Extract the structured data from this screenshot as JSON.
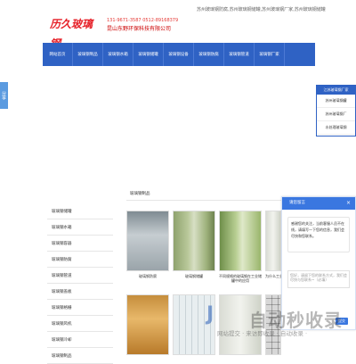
{
  "header": {
    "logo_text": "历久玻璃钢",
    "phone": "131-9671-3587  0512-89168379",
    "company": "昆山东野环保科技有限公司",
    "keywords": "苏州玻璃钢防腐,苏州玻璃钢储罐,苏州玻璃钢厂家,苏州玻璃钢储罐"
  },
  "nav": [
    "网站首页",
    "玻璃钢制品",
    "玻璃钢水箱",
    "玻璃钢储罐",
    "玻璃钢设备",
    "玻璃钢防腐",
    "玻璃钢管道",
    "玻璃钢厂家"
  ],
  "side_tab": "分享",
  "right_widget": {
    "title": "江苏玻璃钢厂家",
    "items": [
      "苏州玻璃钢罐",
      "苏州玻璃钢厂",
      "水处理玻璃钢"
    ]
  },
  "content": {
    "title": "玻璃钢制品"
  },
  "left_menu": [
    "玻璃钢储罐",
    "玻璃钢水箱",
    "玻璃钢容器",
    "玻璃钢防腐",
    "玻璃钢管道",
    "玻璃钢盖板",
    "玻璃钢格栅",
    "玻璃钢风机",
    "玻璃钢冷却",
    "玻璃钢制品"
  ],
  "products": [
    {
      "caption": "玻璃钢防腐"
    },
    {
      "caption": "玻璃钢储罐"
    },
    {
      "caption": "不同规格的玻璃钢在工业储罐中的应用"
    },
    {
      "caption": "为什么工业化选用玻璃钢"
    }
  ],
  "message_panel": {
    "title": "请您留言",
    "close": "×",
    "greeting": "感谢您的关注，当前客服人员不在线，请填写一下您的信息，我们会尽快和您联系。",
    "input_placeholder": "您好，请留下您的联系方式，我们会尽快与您联系~（必填）",
    "send_label": "提交"
  },
  "watermark": {
    "logo": "J",
    "title": "自动秒收录",
    "sub": "网站提交 · 来访即收录 · 自动收录 ·"
  }
}
